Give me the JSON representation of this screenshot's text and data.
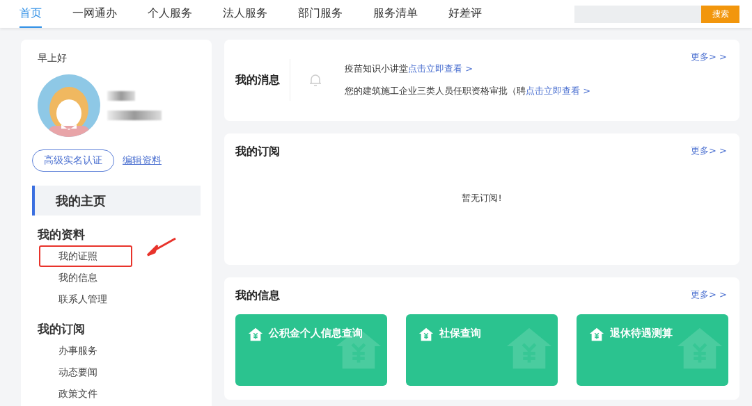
{
  "nav": {
    "tabs": [
      {
        "label": "首页",
        "selected": true
      },
      {
        "label": "一网通办",
        "selected": false
      },
      {
        "label": "个人服务",
        "selected": false
      },
      {
        "label": "法人服务",
        "selected": false
      },
      {
        "label": "部门服务",
        "selected": false
      },
      {
        "label": "服务清单",
        "selected": false
      },
      {
        "label": "好差评",
        "selected": false
      }
    ],
    "search_button": "搜索"
  },
  "profile": {
    "greeting": "早上好",
    "verify_button": "高级实名认证",
    "edit_link": "编辑资料"
  },
  "sidebar": {
    "home": {
      "label": "我的主页",
      "selected": true
    },
    "groups": [
      {
        "title": "我的资料",
        "items": [
          {
            "label": "我的证照",
            "highlighted": true
          },
          {
            "label": "我的信息",
            "highlighted": false
          },
          {
            "label": "联系人管理",
            "highlighted": false
          }
        ]
      },
      {
        "title": "我的订阅",
        "items": [
          {
            "label": "办事服务",
            "highlighted": false
          },
          {
            "label": "动态要闻",
            "highlighted": false
          },
          {
            "label": "政策文件",
            "highlighted": false
          }
        ]
      }
    ]
  },
  "messages": {
    "title": "我的消息",
    "more": "更多> >",
    "items": [
      {
        "text": "疫苗知识小讲堂",
        "link": "点击立即查看 >"
      },
      {
        "text": "您的建筑施工企业三类人员任职资格审批（聘",
        "link": "点击立即查看 >"
      }
    ]
  },
  "subscriptions": {
    "title": "我的订阅",
    "more": "更多> >",
    "empty": "暂无订阅!"
  },
  "info": {
    "title": "我的信息",
    "more": "更多> >",
    "tiles": [
      "公积金个人信息查询",
      "社保查询",
      "退休待遇测算"
    ]
  }
}
